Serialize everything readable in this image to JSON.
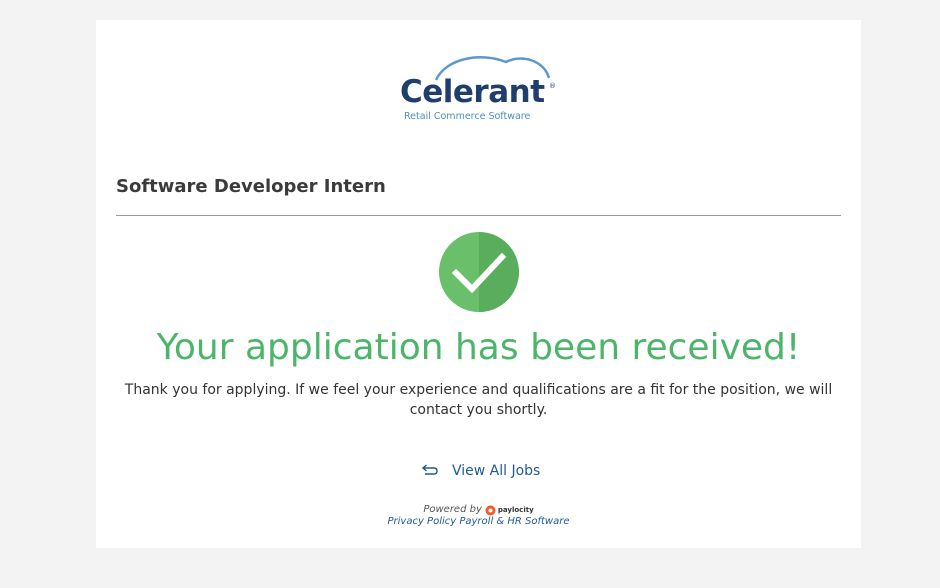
{
  "logo": {
    "wordmark": "Celerant",
    "registered": "®",
    "tagline": "Retail Commerce Software"
  },
  "job": {
    "title": "Software Developer Intern"
  },
  "confirmation": {
    "heading": "Your application has been received!",
    "message": "Thank you for applying. If we feel your experience and qualifications are a fit for the position, we will contact you shortly."
  },
  "actions": {
    "view_all_jobs": "View All Jobs"
  },
  "footer": {
    "powered_by": "Powered by",
    "provider": "paylocity",
    "privacy_policy": "Privacy Policy",
    "payroll_software": "Payroll & HR Software"
  },
  "colors": {
    "success_green": "#4cb56a",
    "link_blue": "#1f5a96",
    "brand_navy": "#1f3e6c"
  },
  "icons": {
    "check": "check-circle-icon",
    "back": "return-arrow-icon"
  }
}
